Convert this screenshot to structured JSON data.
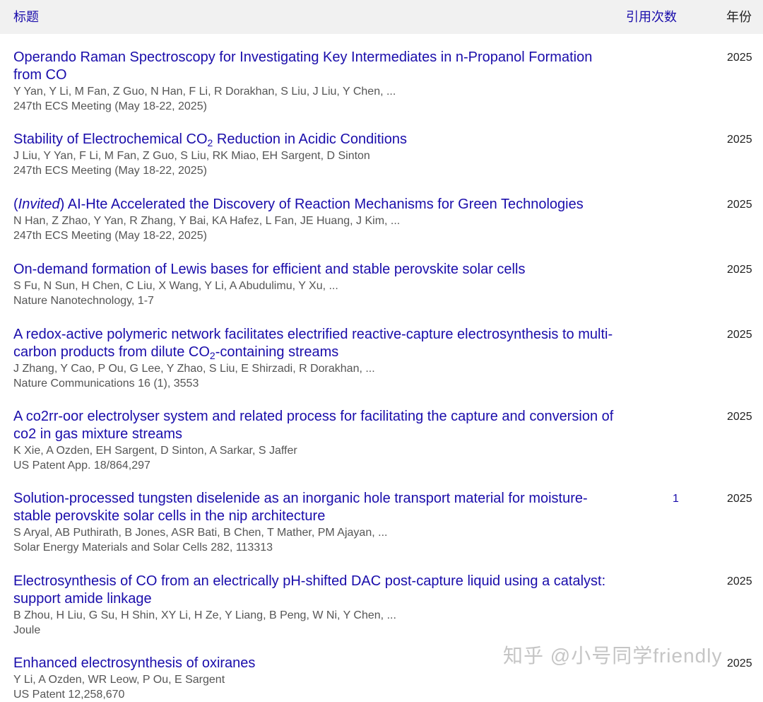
{
  "header": {
    "title": "标题",
    "cites": "引用次数",
    "year": "年份"
  },
  "rows": [
    {
      "title": "Operando Raman Spectroscopy for Investigating Key Intermediates in n-Propanol Formation from CO",
      "authors": "Y Yan, Y Li, M Fan, Z Guo, N Han, F Li, R Dorakhan, S Liu, J Liu, Y Chen, ...",
      "venue": "247th ECS Meeting (May 18-22, 2025)",
      "cites": "",
      "year": "2025"
    },
    {
      "title_pre": "Stability of Electrochemical CO",
      "title_sub": "2",
      "title_post": " Reduction in Acidic Conditions",
      "authors": "J Liu, Y Yan, F Li, M Fan, Z Guo, S Liu, RK Miao, EH Sargent, D Sinton",
      "venue": "247th ECS Meeting (May 18-22, 2025)",
      "cites": "",
      "year": "2025"
    },
    {
      "title_open": "(",
      "title_italic": "Invited",
      "title_post": ") AI-Hte Accelerated the Discovery of Reaction Mechanisms for Green Technologies",
      "authors": "N Han, Z Zhao, Y Yan, R Zhang, Y Bai, KA Hafez, L Fan, JE Huang, J Kim, ...",
      "venue": "247th ECS Meeting (May 18-22, 2025)",
      "cites": "",
      "year": "2025"
    },
    {
      "title": "On-demand formation of Lewis bases for efficient and stable perovskite solar cells",
      "authors": "S Fu, N Sun, H Chen, C Liu, X Wang, Y Li, A Abudulimu, Y Xu, ...",
      "venue": "Nature Nanotechnology, 1-7",
      "cites": "",
      "year": "2025"
    },
    {
      "title_pre": "A redox-active polymeric network facilitates electrified reactive-capture electrosynthesis to multi-carbon products from dilute CO",
      "title_sub": "2",
      "title_post": "-containing streams",
      "authors": "J Zhang, Y Cao, P Ou, G Lee, Y Zhao, S Liu, E Shirzadi, R Dorakhan, ...",
      "venue": "Nature Communications 16 (1), 3553",
      "cites": "",
      "year": "2025"
    },
    {
      "title": "A co2rr-oor electrolyser system and related process for facilitating the capture and conversion of co2 in gas mixture streams",
      "authors": "K Xie, A Ozden, EH Sargent, D Sinton, A Sarkar, S Jaffer",
      "venue": "US Patent App. 18/864,297",
      "cites": "",
      "year": "2025"
    },
    {
      "title": "Solution-processed tungsten diselenide as an inorganic hole transport material for moisture-stable perovskite solar cells in the nip architecture",
      "authors": "S Aryal, AB Puthirath, B Jones, ASR Bati, B Chen, T Mather, PM Ajayan, ...",
      "venue": "Solar Energy Materials and Solar Cells 282, 113313",
      "cites": "1",
      "year": "2025"
    },
    {
      "title": "Electrosynthesis of CO from an electrically pH-shifted DAC post-capture liquid using a catalyst: support amide linkage",
      "authors": "B Zhou, H Liu, G Su, H Shin, XY Li, H Ze, Y Liang, B Peng, W Ni, Y Chen, ...",
      "venue": "Joule",
      "cites": "",
      "year": "2025"
    },
    {
      "title": "Enhanced electrosynthesis of oxiranes",
      "authors": "Y Li, A Ozden, WR Leow, P Ou, E Sargent",
      "venue": "US Patent 12,258,670",
      "cites": "",
      "year": "2025"
    }
  ],
  "watermark": "知乎 @小号同学friendly"
}
